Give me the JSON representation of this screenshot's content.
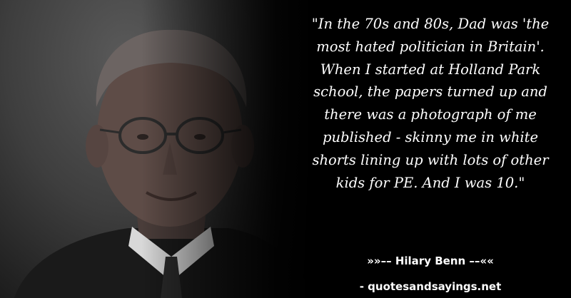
{
  "quote": {
    "text": "\"In the 70s and 80s, Dad was 'the\nmost hated politician in Britain'.\nWhen I started at Holland Park\nschool, the papers turned up and\nthere was a photograph of me\npublished - skinny me in white\nshorts lining up with lots of other\nkids for PE. And I was 10.\""
  },
  "attribution": {
    "author_line": "»»–– Hilary Benn ––««"
  },
  "footer": {
    "site": "- quotesandsayings.net"
  },
  "colors": {
    "background": "#000000",
    "text": "#ffffff"
  }
}
